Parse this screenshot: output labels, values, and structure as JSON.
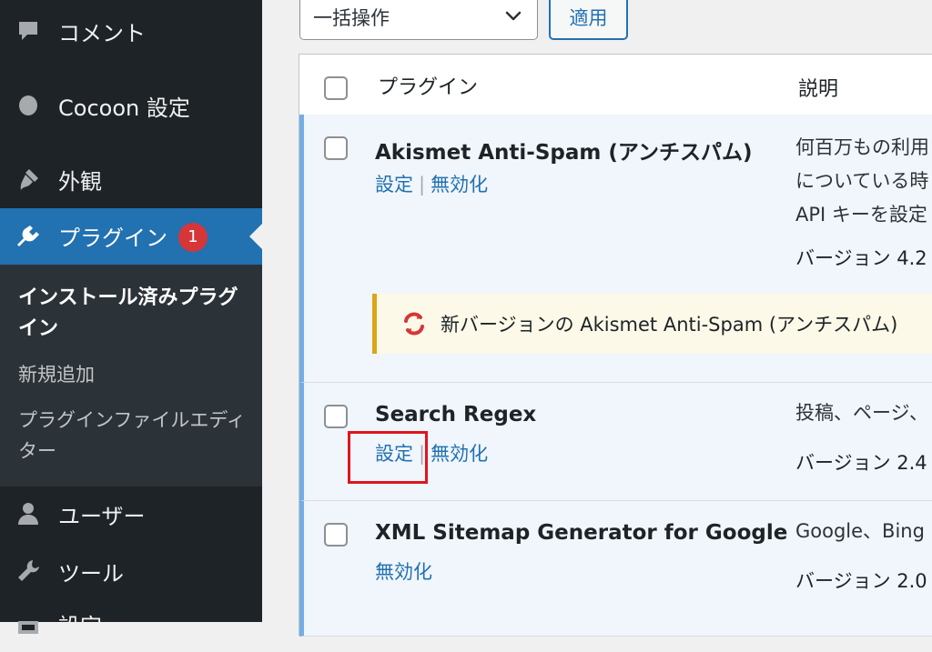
{
  "sidebar": {
    "items": [
      {
        "label": "コメント",
        "icon": "comment-icon"
      },
      {
        "label": "Cocoon 設定",
        "icon": "circle-icon"
      },
      {
        "label": "外観",
        "icon": "paintbrush-icon"
      },
      {
        "label": "プラグイン",
        "icon": "plugin-icon",
        "badge": "1",
        "current": true
      },
      {
        "label": "ユーザー",
        "icon": "user-icon"
      },
      {
        "label": "ツール",
        "icon": "wrench-icon"
      },
      {
        "label": "設定",
        "icon": "settings-icon"
      }
    ],
    "submenu": [
      {
        "label": "インストール済みプラグイン",
        "current": true
      },
      {
        "label": "新規追加"
      },
      {
        "label": "プラグインファイルエディター"
      }
    ]
  },
  "toolbar": {
    "bulk_action": "一括操作",
    "apply_label": "適用"
  },
  "table": {
    "columns": [
      "プラグイン",
      "説明"
    ],
    "rows": [
      {
        "name": "Akismet Anti-Spam (アンチスパム)",
        "actions": [
          "設定",
          "無効化"
        ],
        "description": [
          "何百万もの利用",
          "についている時",
          "API キーを設定"
        ],
        "version": "バージョン 4.2"
      },
      {
        "name": "Search Regex",
        "actions": [
          "設定",
          "無効化"
        ],
        "description": [
          "投稿、ページ、"
        ],
        "version": "バージョン 2.4"
      },
      {
        "name": "XML Sitemap Generator for Google",
        "actions": [
          "無効化"
        ],
        "description": [
          "Google、Bing"
        ],
        "version": "バージョン 2.0"
      }
    ],
    "update_notice": "新バージョンの Akismet Anti-Spam (アンチスパム)"
  },
  "colors": {
    "sidebar_bg": "#1d2327",
    "accent": "#2271b1",
    "badge": "#d63638",
    "notice_border": "#dba617",
    "highlight": "#e0151d"
  }
}
